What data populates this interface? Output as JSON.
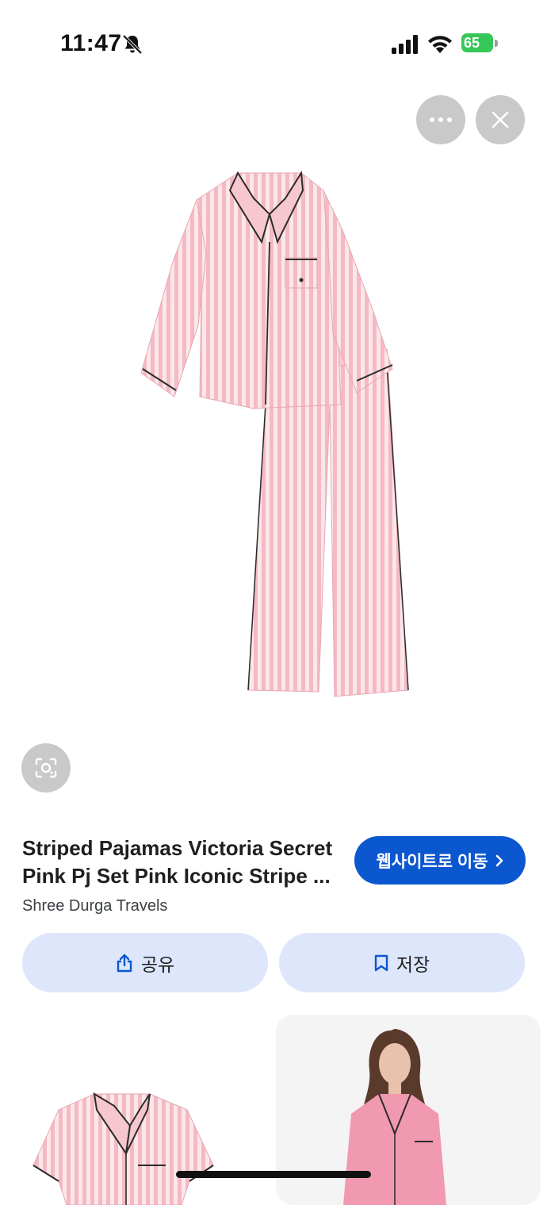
{
  "status_bar": {
    "time": "11:47",
    "battery": "65"
  },
  "product": {
    "title_line1": "Striped Pajamas Victoria Secret",
    "title_line2": "Pink Pj Set Pink Iconic Stripe ...",
    "source": "Shree Durga Travels"
  },
  "buttons": {
    "visit": "웹사이트로 이동",
    "share": "공유",
    "save": "저장"
  },
  "icons": {
    "more": "more-horizontal-icon",
    "close": "close-icon",
    "lens": "lens-search-icon",
    "share": "share-icon",
    "save": "bookmark-icon"
  },
  "colors": {
    "accent": "#0b57d0",
    "tonal_button": "#dde6fb",
    "overlay_button": "#c9c9c9",
    "battery": "#35c759",
    "pajama_pink": "#f6c7cf"
  }
}
